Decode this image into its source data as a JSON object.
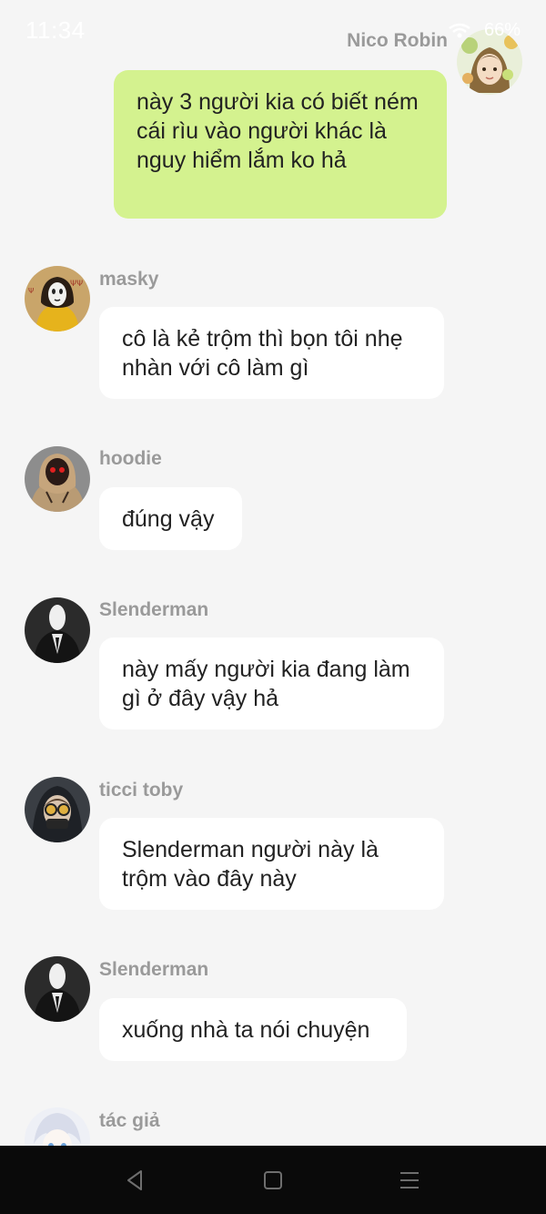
{
  "status_bar": {
    "time": "11:34",
    "battery": "66%"
  },
  "messages": [
    {
      "id": "m1",
      "direction": "outgoing",
      "sender": "Nico Robin",
      "avatar_icon": "anime-girl-avatar-icon",
      "text": "này 3 người kia có biết ném cái rìu vào người khác là nguy hiểm lắm ko hả"
    },
    {
      "id": "m2",
      "direction": "incoming",
      "sender": "masky",
      "avatar_icon": "masky-avatar-icon",
      "text": "cô là kẻ trộm thì bọn tôi nhẹ nhàn với cô làm gì"
    },
    {
      "id": "m3",
      "direction": "incoming",
      "sender": "hoodie",
      "avatar_icon": "hoodie-avatar-icon",
      "text": "đúng vậy"
    },
    {
      "id": "m4",
      "direction": "incoming",
      "sender": "Slenderman",
      "avatar_icon": "slenderman-avatar-icon",
      "text": "này mấy người kia đang làm gì ở đây vậy hả"
    },
    {
      "id": "m5",
      "direction": "incoming",
      "sender": "ticci toby",
      "avatar_icon": "ticci-toby-avatar-icon",
      "text": "Slenderman người này là trộm vào đây này"
    },
    {
      "id": "m6",
      "direction": "incoming",
      "sender": "Slenderman",
      "avatar_icon": "slenderman-avatar-icon",
      "text": "xuống nhà ta nói chuyện"
    },
    {
      "id": "m7",
      "direction": "incoming",
      "sender": "tác giả",
      "avatar_icon": "author-avatar-icon",
      "text": ""
    }
  ],
  "nav_bar": {
    "back_icon": "back-triangle-icon",
    "home_icon": "home-square-icon",
    "menu_icon": "menu-lines-icon"
  },
  "colors": {
    "background": "#f5f5f5",
    "incoming_bubble": "#ffffff",
    "outgoing_bubble": "#d4f28f",
    "sender_name": "#9a9a9a",
    "nav_bar": "#0a0a0a"
  }
}
